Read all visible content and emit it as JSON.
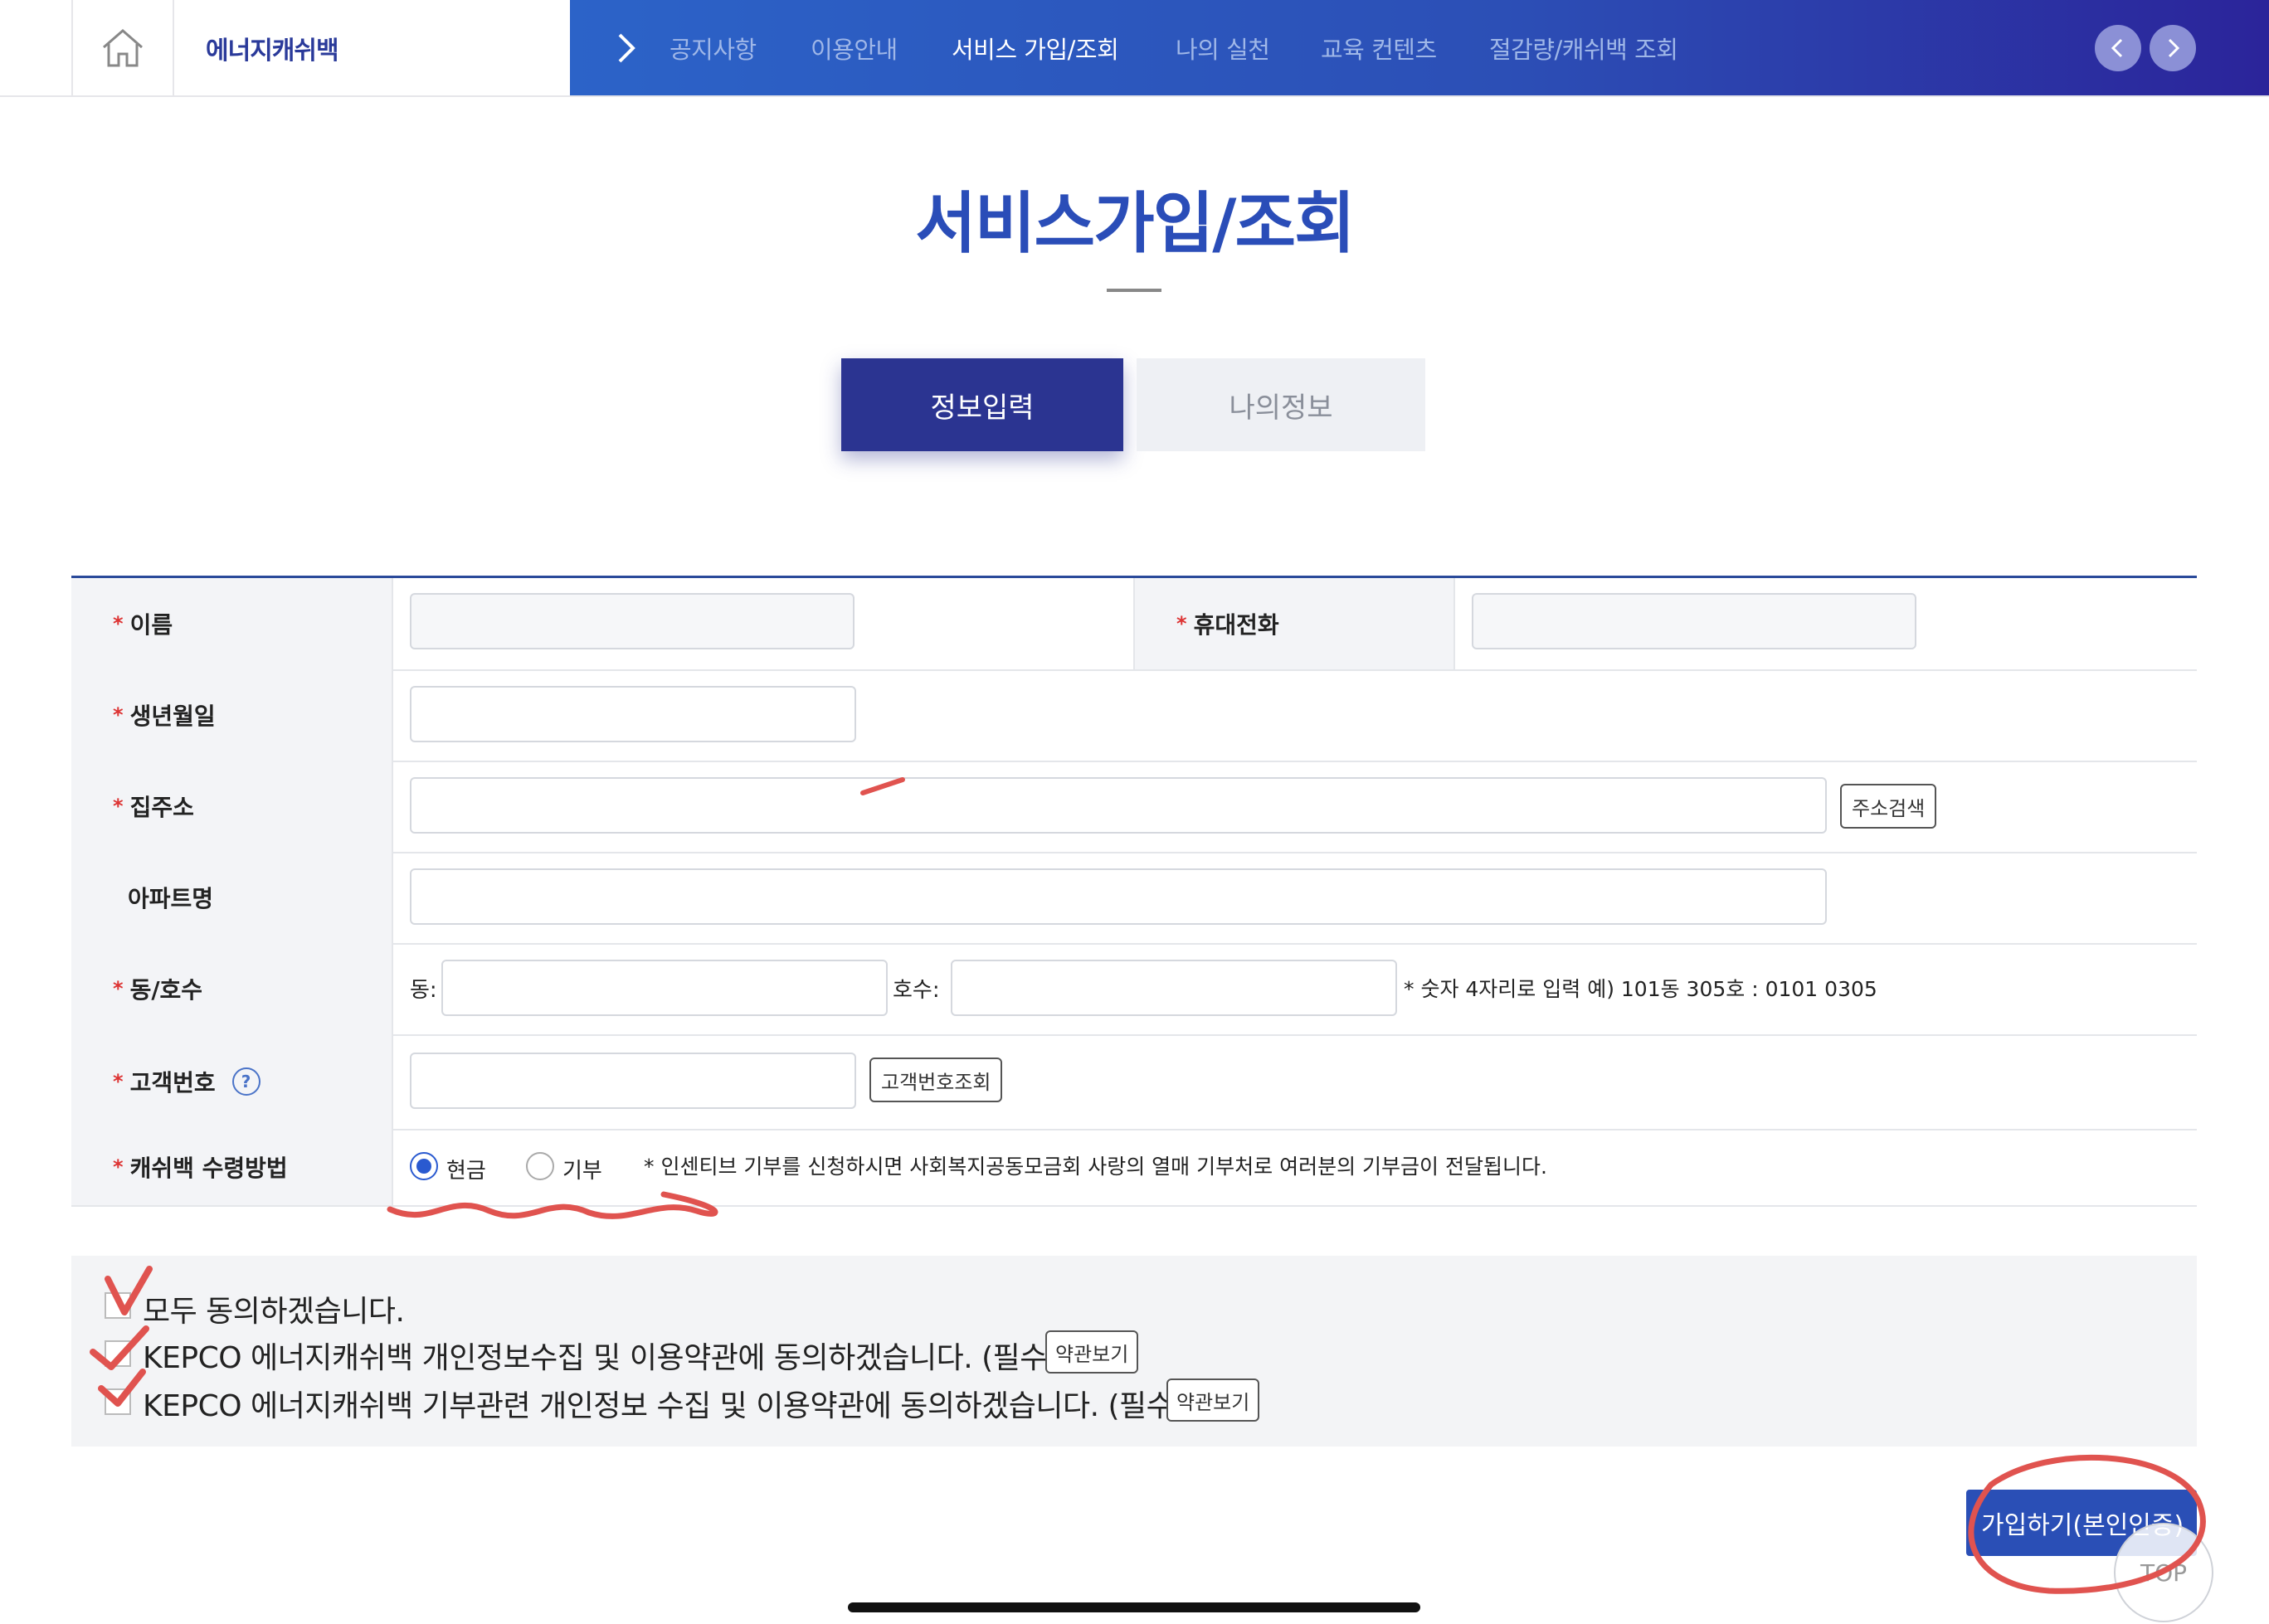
{
  "header": {
    "brand": "에너지캐쉬백",
    "nav": [
      "공지사항",
      "이용안내",
      "서비스 가입/조회",
      "나의 실천",
      "교육 컨텐츠",
      "절감량/캐쉬백 조회"
    ],
    "active_nav_index": 2
  },
  "page": {
    "title": "서비스가입/조회",
    "tabs": [
      "정보입력",
      "나의정보"
    ],
    "active_tab": "정보입력"
  },
  "form": {
    "required_mark": "*",
    "name_label": "이름",
    "phone_label": "휴대전화",
    "birth_label": "생년월일",
    "address_label": "집주소",
    "address_search_btn": "주소검색",
    "apartment_label": "아파트명",
    "dong_ho_label": "동/호수",
    "dong_prefix": "동:",
    "ho_prefix": "호수:",
    "dong_ho_hint": "* 숫자 4자리로 입력 예) 101동 305호 : 0101 0305",
    "customer_no_label": "고객번호",
    "customer_no_help": "?",
    "customer_no_btn": "고객번호조회",
    "cashback_label": "캐쉬백 수령방법",
    "cashback_options": [
      "현금",
      "기부"
    ],
    "cashback_selected": "현금",
    "cashback_hint": "* 인센티브 기부를 신청하시면 사회복지공동모금회 사랑의 열매 기부처로 여러분의 기부금이 전달됩니다."
  },
  "agreements": {
    "all": "모두 동의하겠습니다.",
    "privacy": "KEPCO 에너지캐쉬백 개인정보수집 및 이용약관에 동의하겠습니다. (필수)",
    "donation": "KEPCO 에너지캐쉬백 기부관련 개인정보 수집 및 이용약관에 동의하겠습니다. (필수)",
    "terms_btn": "약관보기"
  },
  "actions": {
    "submit": "가입하기(본인인증)",
    "top": "TOP"
  },
  "colors": {
    "brand_blue": "#2a4db8",
    "tab_active": "#2b3491",
    "annotation_red": "#e0534f"
  }
}
